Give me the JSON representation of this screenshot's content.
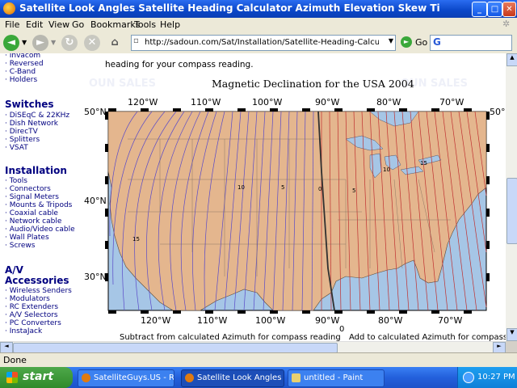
{
  "window": {
    "title": "Satellite Look Angles Satellite Heading Calculator Azimuth Elevation Skew Tilt LNBF Latitude and Longitude valu..."
  },
  "menu": [
    "File",
    "Edit",
    "View",
    "Go",
    "Bookmarks",
    "Tools",
    "Help"
  ],
  "toolbar": {
    "url": "http://sadoun.com/Sat/Installation/Satellite-Heading-Calculator.htm",
    "go_label": "Go",
    "search_label": "G"
  },
  "sidebar": {
    "top_items": [
      "Invacom",
      "Reversed",
      "C-Band",
      "Holders"
    ],
    "sections": [
      {
        "title": "Switches",
        "items": [
          "DiSEqC & 22KHz",
          "Dish Network",
          "DirecTV",
          "Splitters",
          "VSAT"
        ]
      },
      {
        "title": "Installation",
        "items": [
          "Tools",
          "Connectors",
          "Signal Meters",
          "Mounts & Tripods",
          "Coaxial cable",
          "Network cable",
          "Audio/Video cable",
          "Wall Plates",
          "Screws"
        ]
      },
      {
        "title": "A/V Accessories",
        "items": [
          "Wireless Senders",
          "Modulators",
          "RC Extenders",
          "A/V Selectors",
          "PC Converters",
          "InstaJack"
        ]
      }
    ]
  },
  "main": {
    "intro_text": "heading for your compass reading.",
    "watermark": "OUN SALES",
    "map_title": "Magnetic Declination for the USA 2004",
    "lon_labels": [
      "120°W",
      "110°W",
      "100°W",
      "90°W",
      "80°W",
      "70°W"
    ],
    "lat_labels": [
      "50°N",
      "40°N",
      "30°N"
    ],
    "contour_labels": [
      "15",
      "10",
      "5",
      "0",
      "5",
      "10",
      "15"
    ],
    "bottom_left_caption": "Subtract from calculated Azimuth for compass reading",
    "bottom_right_caption": "Add to calculated Azimuth for compass reading",
    "zero_label": "0"
  },
  "status": {
    "text": "Done"
  },
  "taskbar": {
    "start_label": "start",
    "buttons": [
      "SatelliteGuys.US - Re...",
      "Satellite Look Angles ...",
      "untitled - Paint"
    ],
    "clock": "10:27 PM"
  },
  "colors": {
    "land": "#e4b68e",
    "water": "#a6c6e6",
    "west_lines": "#5a4ac8",
    "east_lines": "#c03030",
    "agonic_line": "#303030"
  }
}
